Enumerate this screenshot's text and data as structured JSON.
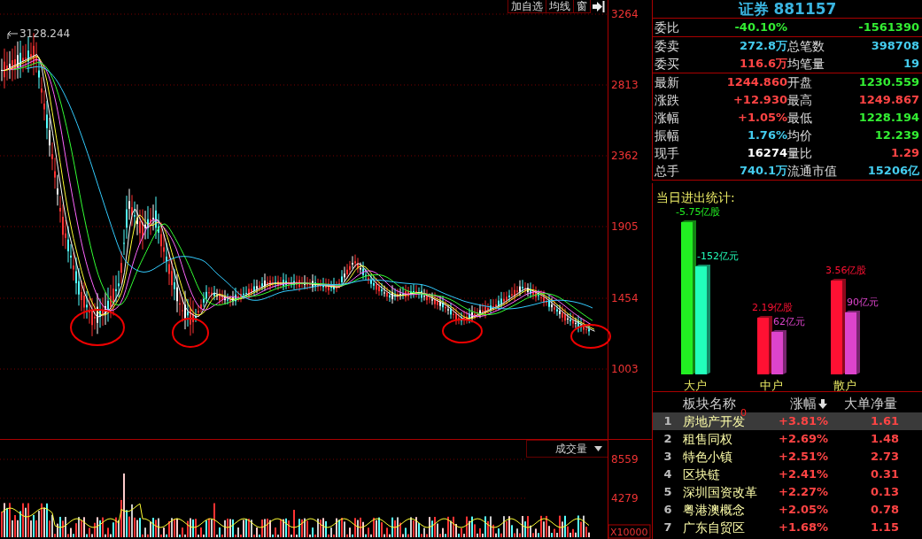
{
  "toolbar": {
    "buttons": [
      "加自选",
      "均线",
      "窗"
    ]
  },
  "price_chart": {
    "peak_label": "3128.244",
    "axis_labels": [
      "3264",
      "2813",
      "2362",
      "1905",
      "1454",
      "1003"
    ]
  },
  "volume_chart": {
    "indicator": "成交量",
    "axis_labels": [
      "8559",
      "4279"
    ],
    "unit": "X10000"
  },
  "quote": {
    "title": "证券 881157",
    "groups": [
      [
        [
          {
            "label": "委比",
            "value": "-40.10%",
            "color": "#33ee33"
          },
          {
            "value": "-1561390",
            "color": "#33ee33"
          }
        ]
      ],
      [
        [
          {
            "label": "委卖",
            "value": "272.8万",
            "color": "#44ccee"
          },
          {
            "label": "总笔数",
            "value": "398708",
            "color": "#44ccee"
          }
        ],
        [
          {
            "label": "委买",
            "value": "116.6万",
            "color": "#ff4444"
          },
          {
            "label": "均笔量",
            "value": "19",
            "color": "#44ccee"
          }
        ]
      ],
      [
        [
          {
            "label": "最新",
            "value": "1244.860",
            "color": "#ff4444"
          },
          {
            "label": "开盘",
            "value": "1230.559",
            "color": "#33ee33"
          }
        ],
        [
          {
            "label": "涨跌",
            "value": "+12.930",
            "color": "#ff4444"
          },
          {
            "label": "最高",
            "value": "1249.867",
            "color": "#ff4444"
          }
        ],
        [
          {
            "label": "涨幅",
            "value": "+1.05%",
            "color": "#ff4444"
          },
          {
            "label": "最低",
            "value": "1228.194",
            "color": "#33ee33"
          }
        ],
        [
          {
            "label": "振幅",
            "value": "1.76%",
            "color": "#44ccee"
          },
          {
            "label": "均价",
            "value": "12.239",
            "color": "#33ee33"
          }
        ],
        [
          {
            "label": "现手",
            "value": "16274",
            "color": "#ffffff"
          },
          {
            "label": "量比",
            "value": "1.29",
            "color": "#ff4444"
          }
        ],
        [
          {
            "label": "总手",
            "value": "740.1万",
            "color": "#44ccee"
          },
          {
            "label": "流通市值",
            "value": "15206亿",
            "color": "#44ccee"
          }
        ]
      ]
    ]
  },
  "flow_stats": {
    "title": "当日进出统计:",
    "groups": [
      {
        "name": "大户",
        "bars": [
          {
            "label": "-5.75亿股",
            "color": "#22ee22"
          },
          {
            "label": "-152亿元",
            "color": "#22ffbb"
          }
        ]
      },
      {
        "name": "中户",
        "bars": [
          {
            "label": "2.19亿股",
            "color": "#ff1133"
          },
          {
            "label": "62亿元",
            "color": "#dd44cc"
          }
        ]
      },
      {
        "name": "散户",
        "bars": [
          {
            "label": "3.56亿股",
            "color": "#ff1133"
          },
          {
            "label": "90亿元",
            "color": "#dd44cc"
          }
        ]
      }
    ]
  },
  "sectors": {
    "columns": [
      {
        "label": "板块名称",
        "sorted": false
      },
      {
        "label": "涨幅",
        "sorted": true
      },
      {
        "label": "大单净量",
        "sorted": false
      }
    ],
    "rows": [
      {
        "rank": "1",
        "name": "房地产开发",
        "change": "+3.81%",
        "net": "1.61",
        "selected": true,
        "badge": "0"
      },
      {
        "rank": "2",
        "name": "租售同权",
        "change": "+2.69%",
        "net": "1.48",
        "selected": false
      },
      {
        "rank": "3",
        "name": "特色小镇",
        "change": "+2.51%",
        "net": "2.73",
        "selected": false
      },
      {
        "rank": "4",
        "name": "区块链",
        "change": "+2.41%",
        "net": "0.31",
        "selected": false
      },
      {
        "rank": "5",
        "name": "深圳国资改革",
        "change": "+2.27%",
        "net": "0.13",
        "selected": false
      },
      {
        "rank": "6",
        "name": "粤港澳概念",
        "change": "+2.05%",
        "net": "0.78",
        "selected": false
      },
      {
        "rank": "7",
        "name": "广东自贸区",
        "change": "+1.68%",
        "net": "1.15",
        "selected": false
      }
    ]
  }
}
